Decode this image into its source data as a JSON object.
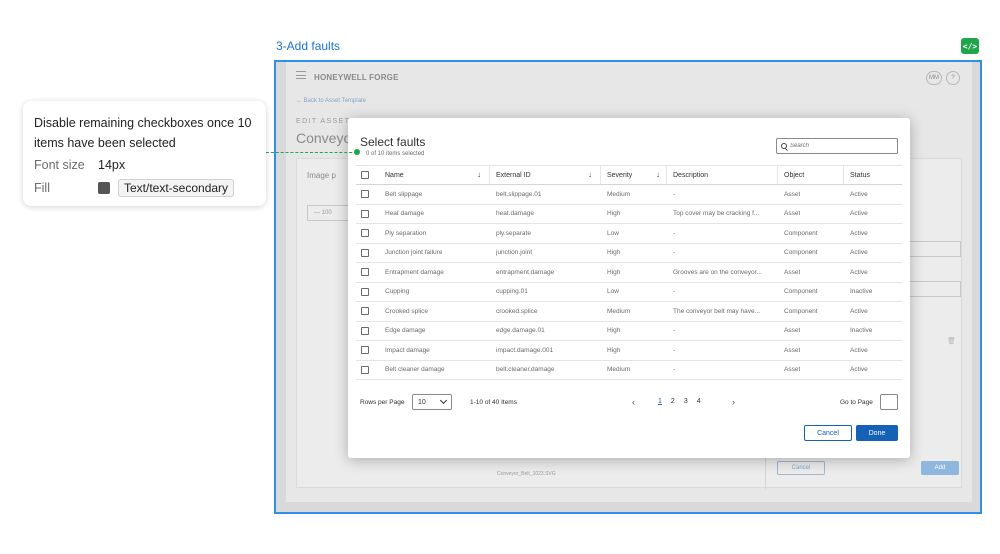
{
  "frame": {
    "title": "3-Add faults",
    "dev_badge": "</>"
  },
  "annotation": {
    "text": "Disable remaining checkboxes once 10 items have been selected",
    "font_size_label": "Font size",
    "font_size_value": "14px",
    "fill_label": "Fill",
    "fill_token": "Text/text-secondary",
    "fill_color": "#555555",
    "connector_color": "#1fa64a"
  },
  "background": {
    "logo": "HONEYWELL FORGE",
    "avatar": "MM",
    "help": "?",
    "back_link": "← Back to Asset Template",
    "edit_label": "EDIT ASSET",
    "page_title": "Conveyor",
    "card_label": "Image p",
    "stepper_value": "—  100",
    "footer_text": "Conveyor_Belt_1023.SVG",
    "cancel_label": "Cancel",
    "add_label": "Add"
  },
  "modal": {
    "title": "Select faults",
    "subtitle": "0 of 10 items selected",
    "search_placeholder": "Search",
    "columns": {
      "name": "Name",
      "external_id": "External ID",
      "severity": "Severity",
      "description": "Description",
      "object": "Object",
      "status": "Status"
    },
    "rows": [
      {
        "name": "Belt slippage",
        "external_id": "belt.slippage.01",
        "severity": "Medium",
        "description": "-",
        "object": "Asset",
        "status": "Active"
      },
      {
        "name": "Heat damage",
        "external_id": "heat.damage",
        "severity": "High",
        "description": "Top cover may be cracking f...",
        "object": "Asset",
        "status": "Active"
      },
      {
        "name": "Ply separation",
        "external_id": "ply.separate",
        "severity": "Low",
        "description": "-",
        "object": "Component",
        "status": "Active"
      },
      {
        "name": "Junction joint failure",
        "external_id": "junction.joint",
        "severity": "High",
        "description": "-",
        "object": "Component",
        "status": "Active"
      },
      {
        "name": "Entrapment damage",
        "external_id": "entrapment.damage",
        "severity": "High",
        "description": "Grooves are on the conveyor...",
        "object": "Asset",
        "status": "Active"
      },
      {
        "name": "Cupping",
        "external_id": "cupping.01",
        "severity": "Low",
        "description": "-",
        "object": "Component",
        "status": "Inactive"
      },
      {
        "name": "Crooked splice",
        "external_id": "crooked.splice",
        "severity": "Medium",
        "description": "The conveyor belt may have...",
        "object": "Component",
        "status": "Active"
      },
      {
        "name": "Edge damage",
        "external_id": "edge.damage.01",
        "severity": "High",
        "description": "-",
        "object": "Asset",
        "status": "Inactive"
      },
      {
        "name": "Impact damage",
        "external_id": "impact.damage.001",
        "severity": "High",
        "description": "-",
        "object": "Asset",
        "status": "Active"
      },
      {
        "name": "Belt cleaner damage",
        "external_id": "belt.cleaner.damage",
        "severity": "Medium",
        "description": "-",
        "object": "Asset",
        "status": "Active"
      }
    ],
    "pagination": {
      "rows_per_page_label": "Rows per Page",
      "rows_per_page_value": "10",
      "range_label": "1-10 of 40 Items",
      "pages": [
        "1",
        "2",
        "3",
        "4"
      ],
      "active_page": "1",
      "prev": "‹",
      "next": "›",
      "goto_label": "Go to Page"
    },
    "cancel_label": "Cancel",
    "done_label": "Done"
  }
}
